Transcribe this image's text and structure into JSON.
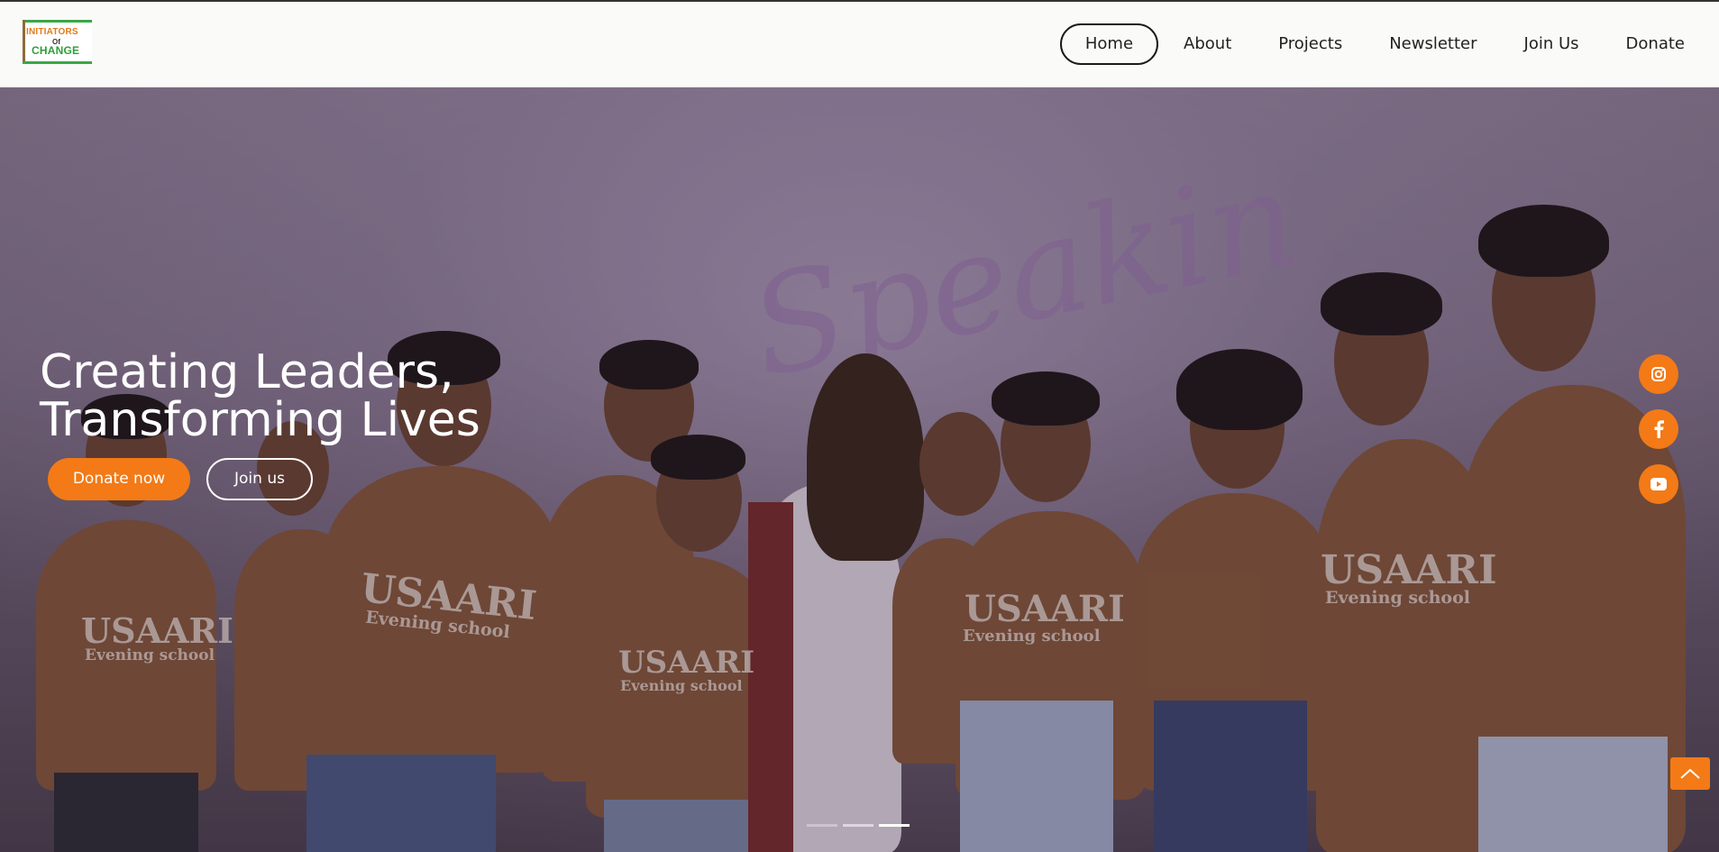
{
  "brand": {
    "logo_line1": "INITIATORS",
    "logo_line2": "Of",
    "logo_line3": "CHANGE",
    "logo_colors": {
      "initiators": "#e07b1a",
      "change": "#2f9e3a"
    }
  },
  "nav": {
    "items": [
      {
        "label": "Home",
        "active": true
      },
      {
        "label": "About"
      },
      {
        "label": "Projects"
      },
      {
        "label": "Newsletter"
      },
      {
        "label": "Join Us"
      },
      {
        "label": "Donate"
      }
    ]
  },
  "hero": {
    "headline_line1": "Creating Leaders,",
    "headline_line2": "Transforming Lives",
    "donate_label": "Donate now",
    "join_label": "Join us",
    "background_text": "Speakin",
    "shirt_text_main": "USAARI",
    "shirt_text_sub": "Evening school",
    "slider": {
      "slide_count": 3,
      "active_slide": 3
    }
  },
  "social": {
    "icons": [
      "instagram-icon",
      "facebook-icon",
      "youtube-icon"
    ]
  },
  "colors": {
    "accent": "#f37a16",
    "nav_text": "#222222",
    "topbar_bg": "#fafaf8"
  }
}
